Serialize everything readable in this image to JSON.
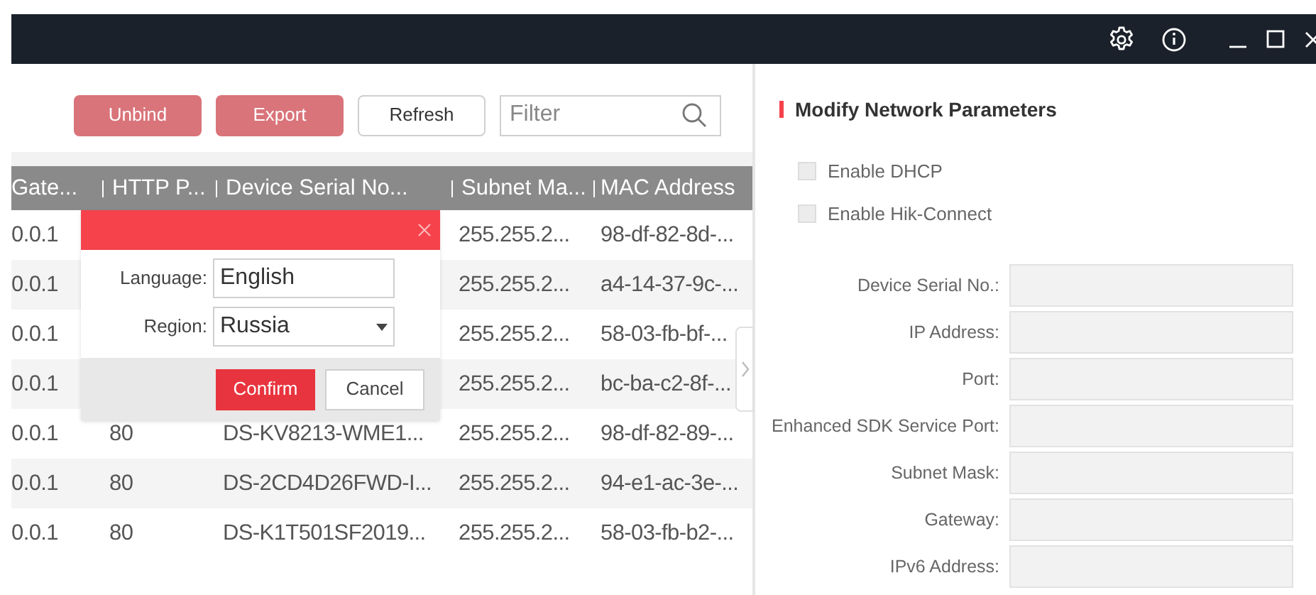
{
  "toolbar": {
    "buttons": [
      {
        "label": "Unbind",
        "disabled": true
      },
      {
        "label": "Export",
        "disabled": true
      },
      {
        "label": "Refresh",
        "disabled": false
      }
    ],
    "filter": {
      "placeholder": "Filter"
    }
  },
  "table": {
    "columns": [
      "Gate...",
      "HTTP P...",
      "Device Serial No...",
      "Subnet Ma...",
      "MAC Address"
    ],
    "rows": [
      {
        "gateway": "0.0.1",
        "subnet": "255.255.2...",
        "mac": "98-df-82-8d-..."
      },
      {
        "gateway": "0.0.1",
        "subnet": "255.255.2...",
        "mac": "a4-14-37-9c-..."
      },
      {
        "gateway": "0.0.1",
        "subnet": "255.255.2...",
        "mac": "58-03-fb-bf-..."
      },
      {
        "gateway": "0.0.1",
        "subnet": "255.255.2...",
        "mac": "bc-ba-c2-8f-..."
      },
      {
        "gateway": "0.0.1",
        "http_port": "80",
        "serial": "DS-KV8213-WME1...",
        "subnet": "255.255.2...",
        "mac": "98-df-82-89-..."
      },
      {
        "gateway": "0.0.1",
        "http_port": "80",
        "serial": "DS-2CD4D26FWD-I...",
        "subnet": "255.255.2...",
        "mac": "94-e1-ac-3e-..."
      },
      {
        "gateway": "0.0.1",
        "http_port": "80",
        "serial": "DS-K1T501SF2019...",
        "subnet": "255.255.2...",
        "mac": "58-03-fb-b2-..."
      }
    ]
  },
  "dialog": {
    "fields": [
      {
        "label": "Language:",
        "value": "English",
        "dropdown": false
      },
      {
        "label": "Region:",
        "value": "Russia",
        "dropdown": true
      }
    ],
    "buttons": [
      {
        "label": "Confirm",
        "primary": true
      },
      {
        "label": "Cancel",
        "primary": false
      }
    ]
  },
  "panel": {
    "title": "Modify Network Parameters",
    "checkboxes": [
      {
        "label": "Enable DHCP",
        "checked": false
      },
      {
        "label": "Enable Hik-Connect",
        "checked": false
      }
    ],
    "fields": [
      "Device Serial No.:",
      "IP Address:",
      "Port:",
      "Enhanced SDK Service Port:",
      "Subnet Mask:",
      "Gateway:",
      "IPv6 Address:"
    ]
  }
}
